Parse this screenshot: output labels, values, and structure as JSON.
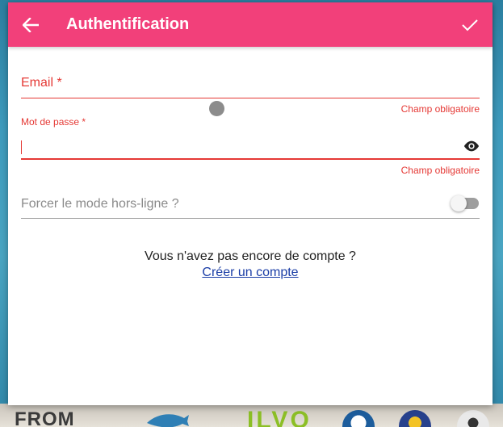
{
  "toolbar": {
    "title": "Authentification",
    "back_icon": "arrow-left-icon",
    "confirm_icon": "check-icon",
    "color": "#f2407a"
  },
  "form": {
    "email_label": "Email *",
    "email_value": "",
    "email_error": "Champ obligatoire",
    "password_label": "Mot de passe *",
    "password_value": "",
    "password_error": "Champ obligatoire",
    "password_toggle_icon": "eye-icon",
    "offline_label": "Forcer le mode hors-ligne ?",
    "offline_enabled": false,
    "error_color": "#e53935"
  },
  "signup": {
    "question": "Vous n'avez pas encore de compte ?",
    "link": "Créer un compte"
  },
  "background": {
    "logo_text_1": "FROM",
    "logo_text_2": "ILVO"
  }
}
